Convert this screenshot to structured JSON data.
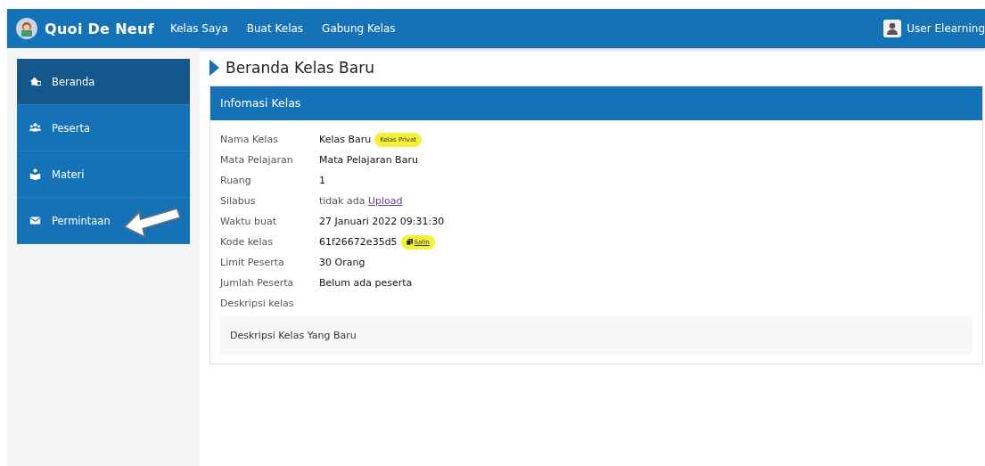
{
  "navbar": {
    "brand": "Quoi De Neuf",
    "links": [
      "Kelas Saya",
      "Buat Kelas",
      "Gabung Kelas"
    ],
    "user": "User Elearning"
  },
  "sidebar": {
    "items": [
      {
        "label": "Beranda",
        "kind": "home",
        "selected": true
      },
      {
        "label": "Peserta",
        "kind": "users",
        "selected": false
      },
      {
        "label": "Materi",
        "kind": "reader",
        "selected": false
      },
      {
        "label": "Permintaan",
        "kind": "mail",
        "selected": false,
        "pointer_arrow": true
      }
    ]
  },
  "page_title": "Beranda Kelas Baru",
  "card": {
    "title": "Infomasi Kelas",
    "rows": [
      {
        "label": "Nama Kelas",
        "kind": "badge",
        "value": "Kelas Baru",
        "badge": "Kelas Privat"
      },
      {
        "label": "Mata Pelajaran",
        "kind": "text",
        "value": "Mata Pelajaran Baru"
      },
      {
        "label": "Ruang",
        "kind": "text",
        "value": "1"
      },
      {
        "label": "Silabus",
        "kind": "link",
        "value": "tidak ada",
        "link": "Upload"
      },
      {
        "label": "Waktu buat",
        "kind": "text",
        "value": "27 Januari 2022 09:31:30"
      },
      {
        "label": "Kode kelas",
        "kind": "copy",
        "value": "61f26672e35d5",
        "button": "Salin"
      },
      {
        "label": "Limit Peserta",
        "kind": "text",
        "value": "30 Orang"
      },
      {
        "label": "Jumlah Peserta",
        "kind": "text",
        "value": "Belum ada peserta"
      }
    ],
    "description_label": "Deskripsi kelas",
    "description": "Deskripsi Kelas Yang Baru"
  }
}
